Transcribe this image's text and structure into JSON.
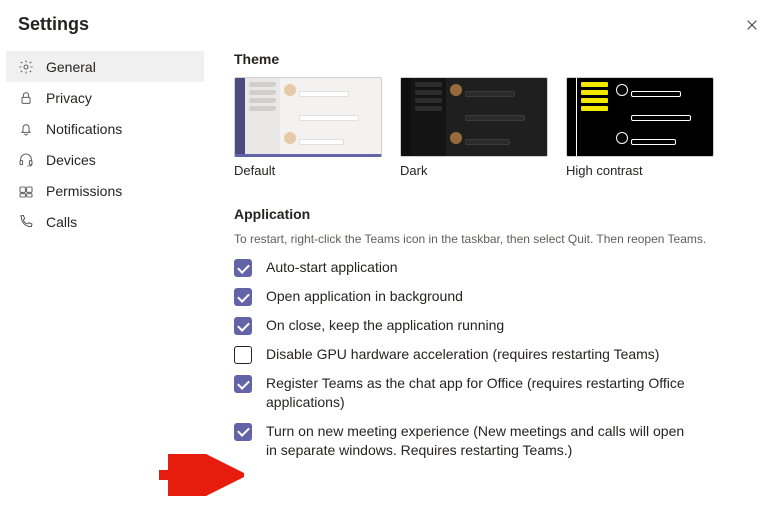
{
  "title": "Settings",
  "sidebar": {
    "items": [
      {
        "label": "General",
        "icon": "gear-icon",
        "active": true
      },
      {
        "label": "Privacy",
        "icon": "lock-icon",
        "active": false
      },
      {
        "label": "Notifications",
        "icon": "bell-icon",
        "active": false
      },
      {
        "label": "Devices",
        "icon": "headset-icon",
        "active": false
      },
      {
        "label": "Permissions",
        "icon": "key-icon",
        "active": false
      },
      {
        "label": "Calls",
        "icon": "phone-icon",
        "active": false
      }
    ]
  },
  "main": {
    "theme_heading": "Theme",
    "themes": [
      {
        "label": "Default",
        "selected": true,
        "variant": "default"
      },
      {
        "label": "Dark",
        "selected": false,
        "variant": "dark"
      },
      {
        "label": "High contrast",
        "selected": false,
        "variant": "hc"
      }
    ],
    "app_heading": "Application",
    "app_hint": "To restart, right-click the Teams icon in the taskbar, then select Quit. Then reopen Teams.",
    "checks": [
      {
        "checked": true,
        "label": "Auto-start application"
      },
      {
        "checked": true,
        "label": "Open application in background"
      },
      {
        "checked": true,
        "label": "On close, keep the application running"
      },
      {
        "checked": false,
        "label": "Disable GPU hardware acceleration (requires restarting Teams)"
      },
      {
        "checked": true,
        "label": "Register Teams as the chat app for Office (requires restarting Office applications)"
      },
      {
        "checked": true,
        "label": "Turn on new meeting experience (New meetings and calls will open in separate windows. Requires restarting Teams.)"
      }
    ]
  }
}
